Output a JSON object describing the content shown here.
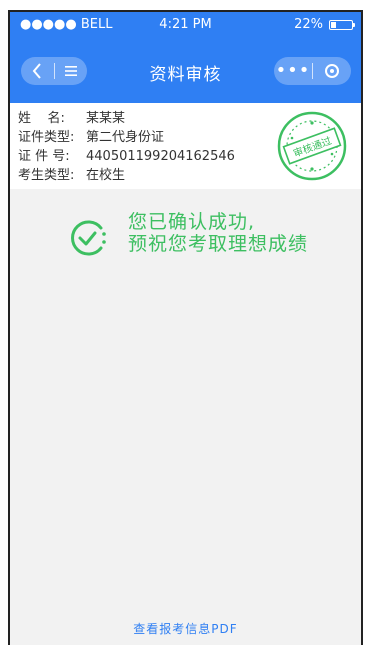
{
  "status_bar": {
    "carrier": "●●●●● BELL",
    "time": "4:21 PM",
    "battery_text": "22%",
    "battery_level": 0.22
  },
  "nav": {
    "title": "资料审核",
    "left_icons": [
      "back-chevron-icon",
      "menu-icon"
    ],
    "right_icons": [
      "more-dots-icon",
      "target-circle-icon"
    ],
    "more_label": "•••"
  },
  "info": {
    "rows": [
      {
        "label": "姓    名:",
        "value": "某某某"
      },
      {
        "label": "证件类型:",
        "value": "第二代身份证"
      },
      {
        "label": "证 件 号:",
        "value": "440501199204162546"
      },
      {
        "label": "考生类型:",
        "value": "在校生"
      }
    ],
    "stamp_text": "审核通过"
  },
  "success": {
    "line1": "您已确认成功,",
    "line2": "预祝您考取理想成绩"
  },
  "footer": {
    "link_text": "查看报考信息PDF"
  },
  "colors": {
    "primary": "#2f7ff3",
    "success": "#3dbf61",
    "background": "#f2f2f2"
  }
}
